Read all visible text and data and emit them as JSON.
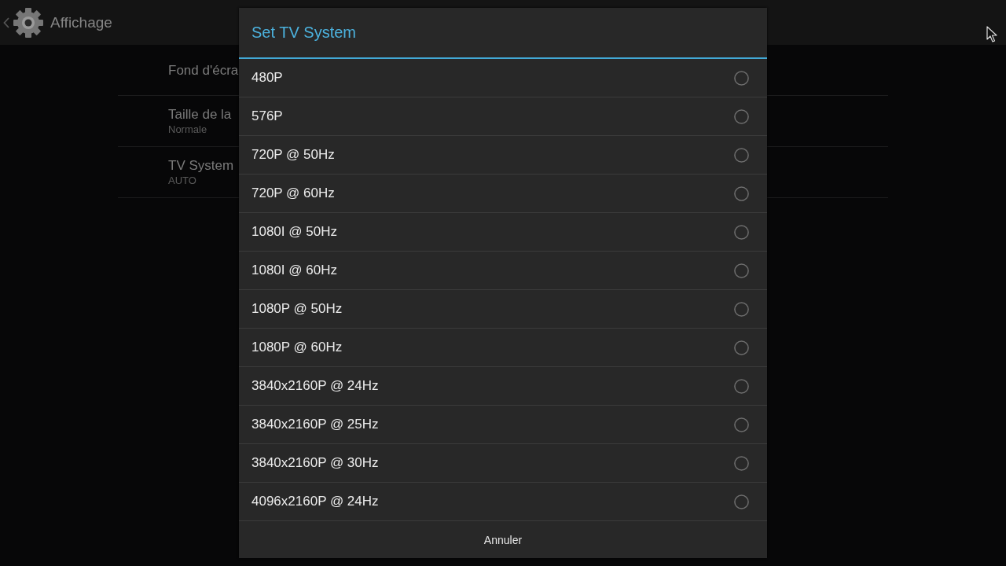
{
  "action_bar": {
    "title": "Affichage"
  },
  "settings": [
    {
      "title": "Fond d'écra"
    },
    {
      "title": "Taille de la",
      "summary": "Normale"
    },
    {
      "title": "TV System",
      "summary": "AUTO"
    }
  ],
  "dialog": {
    "title": "Set TV System",
    "options": [
      {
        "label": "480P",
        "selected": false
      },
      {
        "label": "576P",
        "selected": false
      },
      {
        "label": "720P @ 50Hz",
        "selected": false
      },
      {
        "label": "720P @ 60Hz",
        "selected": false
      },
      {
        "label": "1080I @ 50Hz",
        "selected": false
      },
      {
        "label": "1080I @ 60Hz",
        "selected": false
      },
      {
        "label": "1080P @ 50Hz",
        "selected": false
      },
      {
        "label": "1080P @ 60Hz",
        "selected": false
      },
      {
        "label": "3840x2160P @ 24Hz",
        "selected": false
      },
      {
        "label": "3840x2160P @ 25Hz",
        "selected": false
      },
      {
        "label": "3840x2160P @ 30Hz",
        "selected": false
      },
      {
        "label": "4096x2160P @ 24Hz",
        "selected": false
      }
    ],
    "cancel_button": "Annuler"
  }
}
